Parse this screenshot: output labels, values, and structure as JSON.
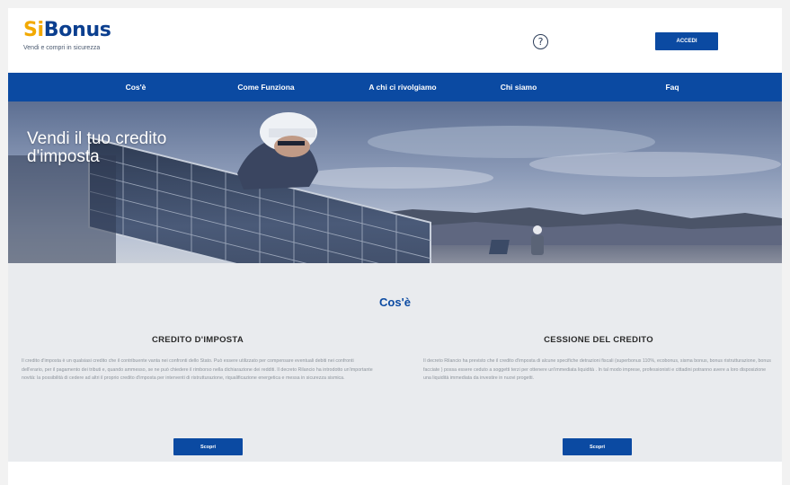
{
  "header": {
    "logo_si": "Si",
    "logo_bonus": "Bonus",
    "tagline": "Vendi e compri in sicurezza",
    "help_glyph": "?",
    "login_label": "ACCEDI"
  },
  "nav": {
    "items": [
      {
        "label": "Cos'è"
      },
      {
        "label": "Come Funziona"
      },
      {
        "label": "A chi ci rivolgiamo"
      },
      {
        "label": "Chi siamo"
      },
      {
        "label": "Faq"
      }
    ]
  },
  "hero": {
    "title_line1": "Vendi il tuo credito",
    "title_line2": "d'imposta"
  },
  "section": {
    "title": "Cos'è",
    "columns": [
      {
        "title": "CREDITO D'IMPOSTA",
        "text": "Il credito d'imposta è un qualsiasi credito che il contribuente vanta nei confronti dello Stato. Può essere utilizzato per compensare eventuali debiti nei confronti dell'erario, per il pagamento dei tributi e, quando ammesso, se ne può chiedere il rimborso nella dichiarazione dei redditi. Il decreto Rilancio ha introdotto un'importante novità: la possibilità di cedere ad altri il proprio credito d'imposta per interventi di ristrutturazione, riqualificazione energetica e messa in sicurezza sismica.",
        "button": "Scopri"
      },
      {
        "title": "CESSIONE DEL CREDITO",
        "text": "Il decreto Rilancio ha previsto che il credito d'imposta di alcune specifiche detrazioni fiscali (superbonus 110%, ecobonus, sisma bonus, bonus ristrutturazione, bonus facciate ) possa essere ceduto a soggetti terzi per ottenere un'immediata liquidità . In tal modo imprese, professionisti e cittadini potranno avere a loro disposizione una liquidità immediata da investire in nuovi progetti.",
        "button": "Scopri"
      }
    ]
  },
  "colors": {
    "brand_blue": "#0b4aa2",
    "logo_orange": "#f2a900",
    "logo_blue": "#0b3f8f",
    "section_bg": "#e9ebee"
  }
}
